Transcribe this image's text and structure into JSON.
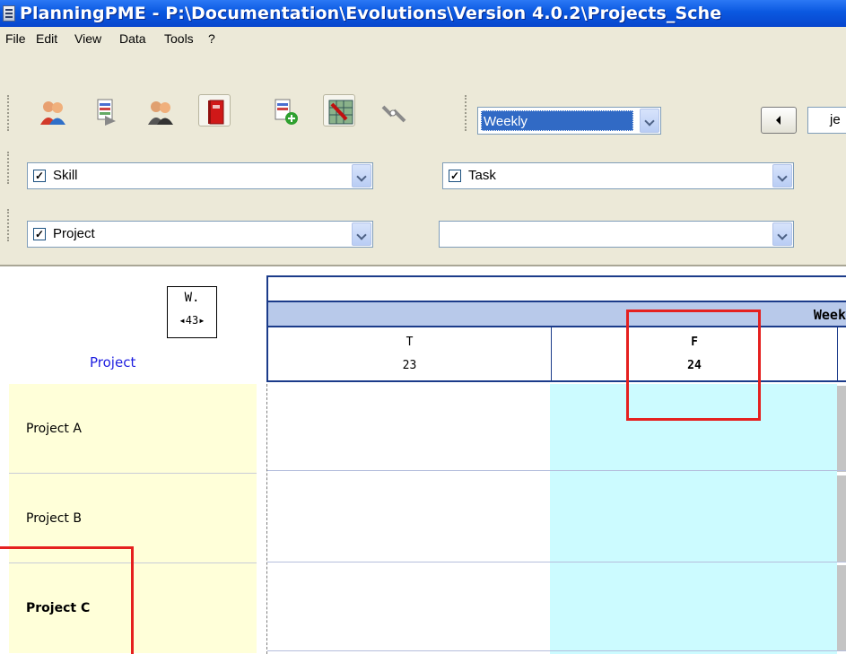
{
  "window": {
    "title": "PlanningPME - P:\\Documentation\\Evolutions\\Version 4.0.2\\Projects_Sche"
  },
  "menu": [
    "File",
    "Edit",
    "View",
    "Data",
    "Tools",
    "?"
  ],
  "toolbar": {
    "icons": [
      "resources-icon",
      "planning-report-icon",
      "customers-icon",
      "project-book-icon",
      "add-task-icon",
      "grid-view-icon",
      "link-icon"
    ],
    "view_select": "Weekly",
    "date_field": "je"
  },
  "filters": {
    "row1_left": {
      "label": "Skill",
      "checked": true
    },
    "row1_right": {
      "label": "Task",
      "checked": true
    },
    "row2_left": {
      "label": "Project",
      "checked": true
    },
    "row2_right": {
      "label": "",
      "checked": false
    }
  },
  "grid": {
    "corner": {
      "unit": "W.",
      "nav": "◂43▸"
    },
    "row_header": "Project",
    "week_label": "Week",
    "days": [
      {
        "letter": "T",
        "number": "23"
      },
      {
        "letter": "F",
        "number": "24"
      }
    ],
    "rows": [
      "Project A",
      "Project B",
      "Project C"
    ]
  },
  "colors": {
    "titlebar": "#0a58e0",
    "today_column": "#ccfbff",
    "row_label_bg": "#ffffd9",
    "week_band": "#b8c9ea",
    "highlight": "#e5201f"
  }
}
